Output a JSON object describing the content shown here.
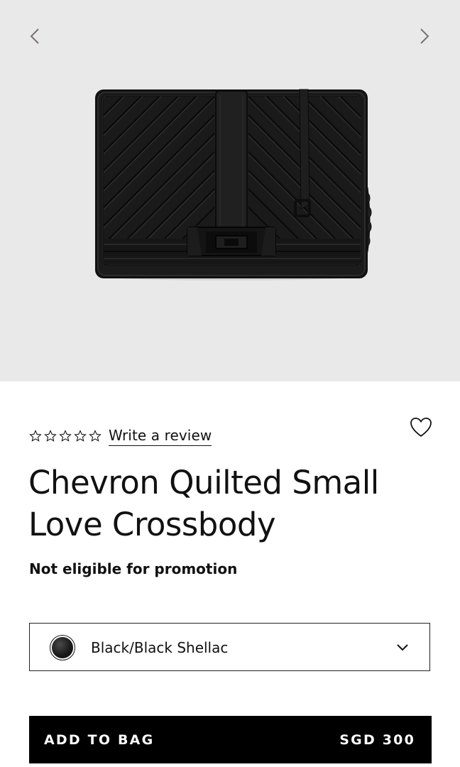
{
  "gallery": {
    "prev_icon": "chevron-left-icon",
    "next_icon": "chevron-right-icon",
    "image_alt": "Chevron Quilted Small Love Crossbody"
  },
  "product": {
    "rating_stars": 0,
    "rating_max": 5,
    "write_review_label": "Write a review",
    "title": "Chevron Quilted Small Love Crossbody",
    "promo_note": "Not eligible for promotion",
    "wishlist_icon": "heart-outline-icon"
  },
  "color_select": {
    "selected_value": "Black/Black Shellac",
    "swatch_color": "#1a1a1a",
    "dropdown_icon": "chevron-down-icon"
  },
  "cta": {
    "add_label": "ADD TO BAG",
    "price": "SGD 300",
    "background": "#000000",
    "text_color": "#ffffff"
  },
  "colors": {
    "gallery_bg": "#e9e9ea",
    "page_bg": "#ffffff",
    "text": "#111111",
    "arrow": "#7a7272"
  }
}
